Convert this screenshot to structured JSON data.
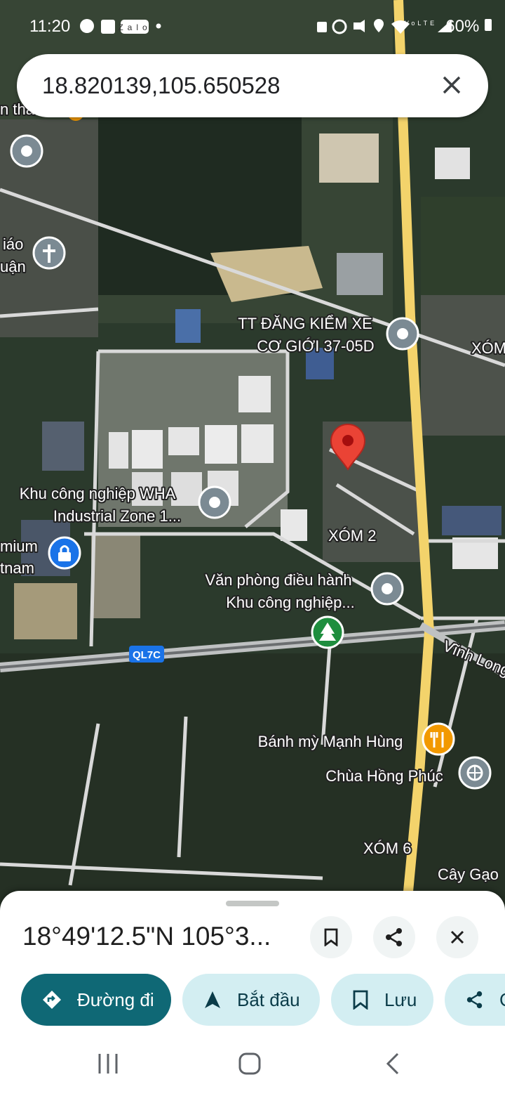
{
  "status_bar": {
    "time": "11:20",
    "notification_icons": [
      "messenger-icon",
      "shopee-icon",
      "zalo-icon",
      "dot-icon"
    ],
    "zalo_label": "Zalo",
    "system_icons": [
      "lock-icon",
      "alarm-icon",
      "mute-icon",
      "location-icon",
      "wifi-icon",
      "volte-icon",
      "signal-icon"
    ],
    "volte_label": "VoLTE",
    "battery": "60%"
  },
  "search": {
    "query": "18.820139,105.650528",
    "clear_icon": "close-icon"
  },
  "map": {
    "labels": {
      "top_left_partial": "n tha",
      "giao": "iáo",
      "luan": "uận",
      "dang_kiem_line1": "TT ĐĂNG KIỂM XE",
      "dang_kiem_line2": "CƠ GIỚI 37-05D",
      "xom_right": "XÓM",
      "wha_line1": "Khu công nghiệp WHA",
      "wha_line2": "Industrial Zone 1...",
      "premium_line1": "mium",
      "premium_line2": "tnam",
      "xom2": "XÓM 2",
      "vpdh_line1": "Văn phòng điều hành",
      "vpdh_line2": "Khu công nghiệp...",
      "road_badge": "QL7C",
      "vinh_long": "Vĩnh Long B",
      "banh_my": "Bánh mỳ Mạnh Hùng",
      "chua": "Chùa Hồng Phúc",
      "xom6": "XÓM 6",
      "cay_gao": "Cây Gạo"
    },
    "colors": {
      "satellite_dark": "#2b3a2c",
      "field": "#3c4a36",
      "road_main": "#f3d36b",
      "pin_red": "#ea4335",
      "poi_gray": "#7b8a93",
      "poi_green": "#1e8e3e",
      "poi_orange": "#f29900",
      "poi_blue": "#1a73e8"
    }
  },
  "sheet": {
    "coordinates": "18°49'12.5\"N 105°3...",
    "save_icon": "bookmark-icon",
    "share_icon": "share-icon",
    "close_icon": "close-icon",
    "chips": [
      {
        "label": "Đường đi",
        "icon": "directions-icon"
      },
      {
        "label": "Bắt đầu",
        "icon": "navigation-icon"
      },
      {
        "label": "Lưu",
        "icon": "bookmark-icon"
      },
      {
        "label": "C",
        "icon": "share-icon"
      }
    ],
    "colors": {
      "primary_chip": "#0f6875",
      "chip": "#d3eef2"
    }
  },
  "nav_bar": {
    "buttons": [
      "recents-icon",
      "home-icon",
      "back-icon"
    ]
  }
}
